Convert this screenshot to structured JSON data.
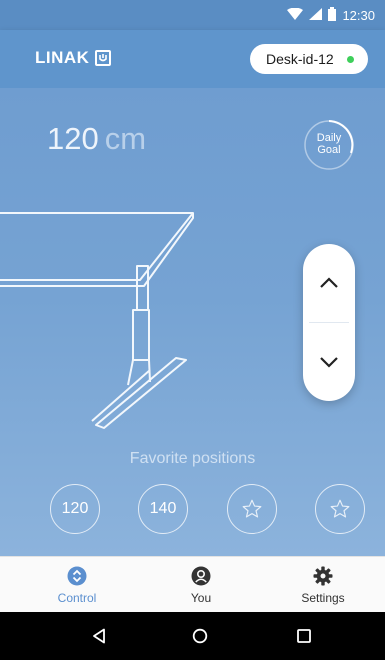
{
  "status_bar": {
    "time": "12:30"
  },
  "header": {
    "logo_text": "LINAK",
    "desk_id": "Desk-id-12",
    "connection_color": "#3ecf5a"
  },
  "control": {
    "height_value": "120",
    "height_unit": "cm",
    "daily_goal": {
      "line1": "Daily",
      "line2": "Goal"
    },
    "up_icon": "chevron-up-icon",
    "down_icon": "chevron-down-icon"
  },
  "favorites": {
    "title": "Favorite positions",
    "items": [
      {
        "label": "120",
        "type": "value"
      },
      {
        "label": "140",
        "type": "value"
      },
      {
        "label": "",
        "type": "empty-star"
      },
      {
        "label": "",
        "type": "empty-star"
      }
    ]
  },
  "bottom_nav": {
    "items": [
      {
        "label": "Control",
        "icon": "control-icon",
        "active": true
      },
      {
        "label": "You",
        "icon": "user-icon",
        "active": false
      },
      {
        "label": "Settings",
        "icon": "gear-icon",
        "active": false
      }
    ]
  },
  "system_nav": {
    "back": "back-icon",
    "home": "home-icon",
    "recents": "recents-icon"
  },
  "colors": {
    "accent": "#5b8fcf",
    "header": "#5f95cc",
    "background": "#76a3d3"
  }
}
